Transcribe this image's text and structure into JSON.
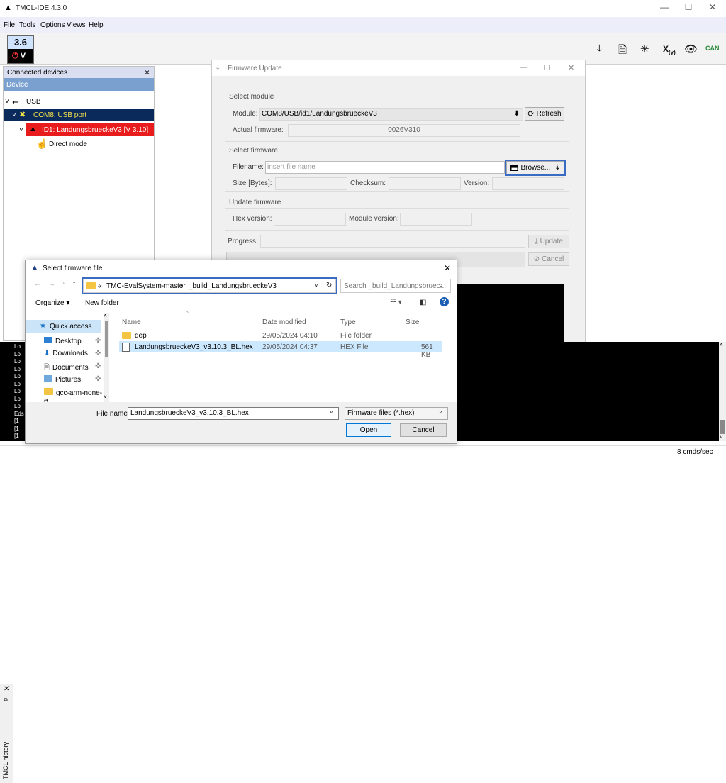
{
  "app": {
    "title": "TMCL-IDE 4.3.0",
    "menu": [
      "File",
      "Tools",
      "Options",
      "Views",
      "Help"
    ],
    "version_badge": "3.6",
    "badge_sub": "V"
  },
  "toolbar_icons": [
    "download-icon",
    "file-search-icon",
    "magic-wand-icon",
    "xy-plot-icon",
    "eye-icon",
    "can-icon"
  ],
  "connected_devices": {
    "title": "Connected devices",
    "close": "×",
    "column": "Device",
    "tree": [
      {
        "label": "USB",
        "level": 0
      },
      {
        "label": "COM8: USB port",
        "level": 1
      },
      {
        "label": "ID1: LandungsbrueckeV3 [V 3.10]",
        "level": 2
      },
      {
        "label": "Direct mode",
        "level": 3
      }
    ]
  },
  "firmware_update": {
    "title": "Firmware Update",
    "select_module_label": "Select module",
    "module_label": "Module:",
    "module_value": "COM8/USB/id1/LandungsbrueckeV3",
    "refresh": "Refresh",
    "actual_fw_label": "Actual firmware:",
    "actual_fw_value": "0026V310",
    "select_fw_label": "Select firmware",
    "filename_label": "Filename:",
    "filename_placeholder": "insert file name",
    "browse": "Browse...",
    "size_label": "Size [Bytes]:",
    "checksum_label": "Checksum:",
    "version_label": "Version:",
    "update_fw_label": "Update firmware",
    "hex_version_label": "Hex version:",
    "module_version_label": "Module version:",
    "progress_label": "Progress:",
    "update_btn": "Update",
    "cancel_btn": "Cancel"
  },
  "file_dialog": {
    "title": "Select firmware file",
    "breadcrumb": [
      "TMC-EvalSystem-master",
      "_build_LandungsbrueckeV3"
    ],
    "search_placeholder": "Search _build_Landungsbruec...",
    "organize": "Organize",
    "new_folder": "New folder",
    "quick_access": "Quick access",
    "sidebar": [
      "Desktop",
      "Downloads",
      "Documents",
      "Pictures",
      "gcc-arm-none-e"
    ],
    "columns": [
      "Name",
      "Date modified",
      "Type",
      "Size"
    ],
    "files": [
      {
        "name": "dep",
        "date": "29/05/2024 04:10",
        "type": "File folder",
        "size": ""
      },
      {
        "name": "LandungsbrueckeV3_v3.10.3_BL.hex",
        "date": "29/05/2024 04:37",
        "type": "HEX File",
        "size": "561 KB"
      }
    ],
    "filename_label": "File name:",
    "filename_value": "LandungsbrueckeV3_v3.10.3_BL.hex",
    "filter": "Firmware files (*.hex)",
    "open": "Open",
    "cancel": "Cancel"
  },
  "history": {
    "label": "TMCL history",
    "lines": [
      "Lo",
      "Lo",
      "Lo",
      "Lo",
      "Lo",
      "Lo",
      "Lo",
      "Lo",
      "Lo",
      "Eds",
      "[1",
      "[1",
      "[1"
    ]
  },
  "status": {
    "rate": "8 cmds/sec"
  }
}
